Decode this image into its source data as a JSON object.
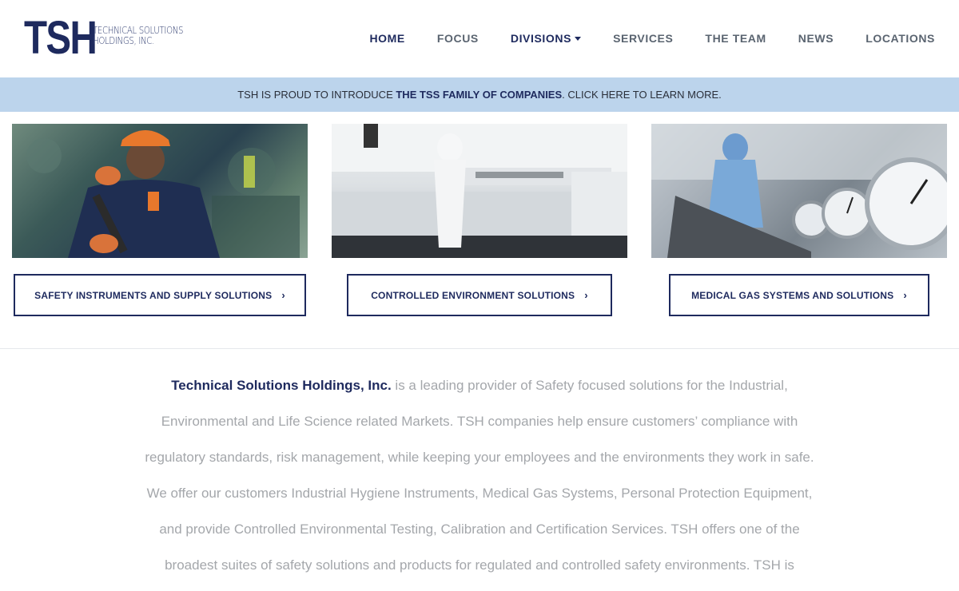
{
  "logo": {
    "mark": "TSH",
    "line1": "TECHNICAL SOLUTIONS",
    "line2": "HOLDINGS, INC."
  },
  "nav": {
    "items": [
      {
        "label": "HOME"
      },
      {
        "label": "FOCUS"
      },
      {
        "label": "DIVISIONS"
      },
      {
        "label": "SERVICES"
      },
      {
        "label": "THE TEAM"
      },
      {
        "label": "NEWS"
      },
      {
        "label": "LOCATIONS"
      }
    ]
  },
  "banner": {
    "prefix": "TSH IS PROUD TO INTRODUCE ",
    "highlight": "THE TSS FAMILY OF COMPANIES",
    "suffix": ". CLICK HERE TO LEARN MORE."
  },
  "divisions": [
    {
      "label": "SAFETY INSTRUMENTS AND SUPPLY SOLUTIONS",
      "chevron": "›"
    },
    {
      "label": "CONTROLLED ENVIRONMENT SOLUTIONS",
      "chevron": "›"
    },
    {
      "label": "MEDICAL GAS SYSTEMS AND SOLUTIONS",
      "chevron": "›"
    }
  ],
  "about": {
    "lead": "Technical Solutions Holdings, Inc.",
    "lines": [
      " is a leading provider of Safety focused solutions for the Industrial,",
      "Environmental and Life Science related Markets. TSH companies help ensure customers’ compliance with",
      "regulatory standards, risk management, while keeping your employees and the environments they work in safe.",
      "We offer our customers Industrial Hygiene Instruments, Medical Gas Systems, Personal Protection Equipment,",
      "and provide Controlled Environmental Testing, Calibration and Certification Services. TSH offers one of the",
      "broadest suites of safety solutions and products for regulated and controlled safety environments. TSH is"
    ]
  },
  "colors": {
    "brand_navy": "#1e2a5e",
    "banner_bg": "#bcd4ec",
    "body_text": "#a4a7ab"
  }
}
